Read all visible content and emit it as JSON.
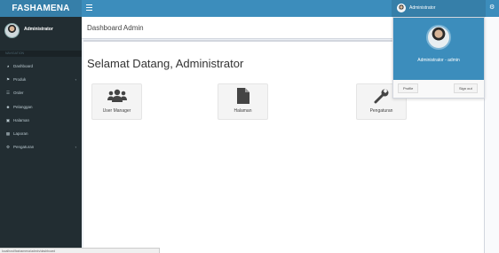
{
  "app": {
    "logo": "FASHAMENA"
  },
  "header": {
    "user_name": "Administrator"
  },
  "sidebar": {
    "user_name": "Administrator",
    "section_header": "NAVIGATION",
    "items": [
      {
        "label": "Dashboard",
        "icon": "dashboard-icon",
        "has_children": false
      },
      {
        "label": "Produk",
        "icon": "tags-icon",
        "has_children": true
      },
      {
        "label": "Order",
        "icon": "list-icon",
        "has_children": false
      },
      {
        "label": "Pelanggan",
        "icon": "users-icon",
        "has_children": false
      },
      {
        "label": "Halaman",
        "icon": "file-icon",
        "has_children": false
      },
      {
        "label": "Laporan",
        "icon": "report-icon",
        "has_children": false
      },
      {
        "label": "Pengaturan",
        "icon": "cogs-icon",
        "has_children": true
      }
    ]
  },
  "content": {
    "page_title": "Dashboard Admin",
    "welcome": "Selamat Datang, Administrator",
    "tiles": [
      {
        "label": "User Manager",
        "icon": "users-icon"
      },
      {
        "label": "Halaman",
        "icon": "file-icon"
      },
      {
        "label": "Pengaturan",
        "icon": "wrench-icon"
      }
    ]
  },
  "dropdown": {
    "name": "Administrator - admin",
    "profile_label": "Profile",
    "signout_label": "Sign out"
  },
  "statusbar": {
    "url": "localhost/fashamena/admin/dashboard"
  },
  "colors": {
    "header": "#3c8dbc",
    "header_dark": "#367fa9",
    "sidebar": "#222d32",
    "content_bg": "#ecf0f5"
  }
}
